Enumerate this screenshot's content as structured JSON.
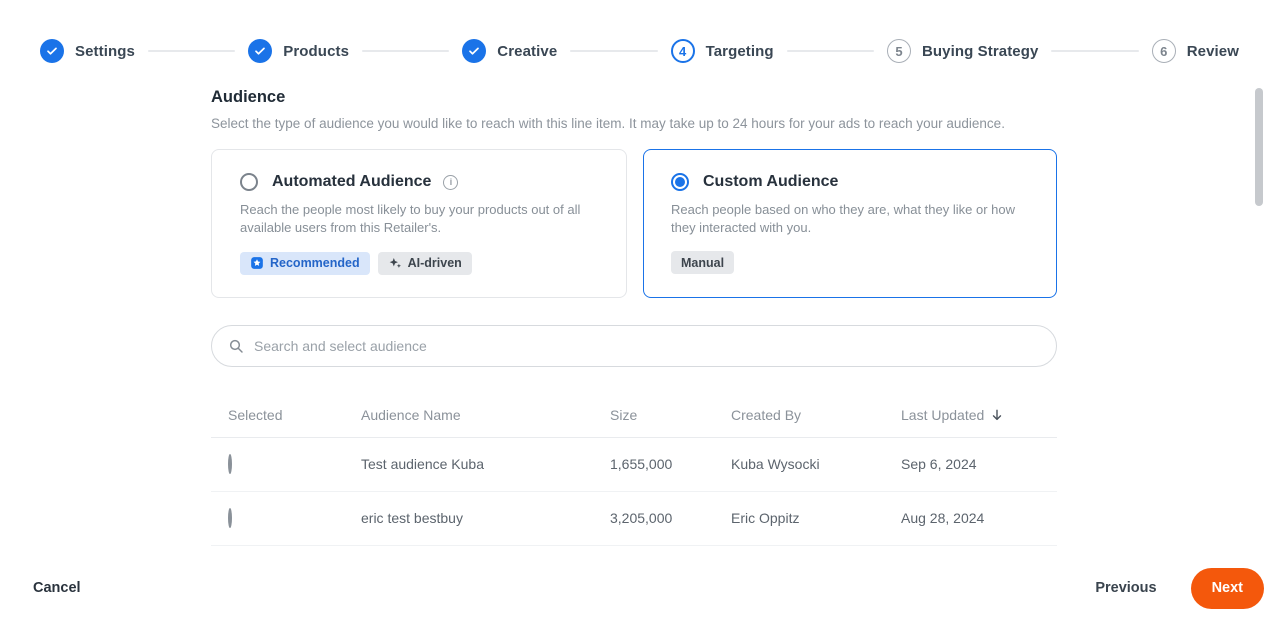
{
  "stepper": {
    "steps": [
      {
        "label": "Settings",
        "state": "complete"
      },
      {
        "label": "Products",
        "state": "complete"
      },
      {
        "label": "Creative",
        "state": "complete"
      },
      {
        "label": "Targeting",
        "state": "current",
        "number": "4"
      },
      {
        "label": "Buying Strategy",
        "state": "upcoming",
        "number": "5"
      },
      {
        "label": "Review",
        "state": "upcoming",
        "number": "6"
      }
    ]
  },
  "audience": {
    "title": "Audience",
    "subtitle": "Select the type of audience you would like to reach with this line item. It may take up to 24 hours for your ads to reach your audience."
  },
  "cards": [
    {
      "title": "Automated Audience",
      "description": "Reach the people most likely to buy your products out of all available users from this Retailer's.",
      "selected": false,
      "badges": [
        {
          "label": "Recommended"
        },
        {
          "label": "AI-driven"
        }
      ]
    },
    {
      "title": "Custom Audience",
      "description": "Reach people based on who they are, what they like or how they interacted with you.",
      "selected": true,
      "badges": [
        {
          "label": "Manual"
        }
      ]
    }
  ],
  "search": {
    "placeholder": "Search and select audience"
  },
  "table": {
    "headers": {
      "selected": "Selected",
      "name": "Audience Name",
      "size": "Size",
      "created_by": "Created By",
      "last_updated": "Last Updated"
    },
    "rows": [
      {
        "name": "Test audience Kuba",
        "size": "1,655,000",
        "created_by": "Kuba Wysocki",
        "last_updated": "Sep 6, 2024"
      },
      {
        "name": "eric test bestbuy",
        "size": "3,205,000",
        "created_by": "Eric Oppitz",
        "last_updated": "Aug 28, 2024"
      }
    ]
  },
  "footer": {
    "cancel": "Cancel",
    "previous": "Previous",
    "next": "Next"
  },
  "colors": {
    "accent_blue": "#1A73E8",
    "next_orange": "#F4580C",
    "badge_blue_bg": "#D9E6FA",
    "badge_gray_bg": "#E6E8EB"
  }
}
